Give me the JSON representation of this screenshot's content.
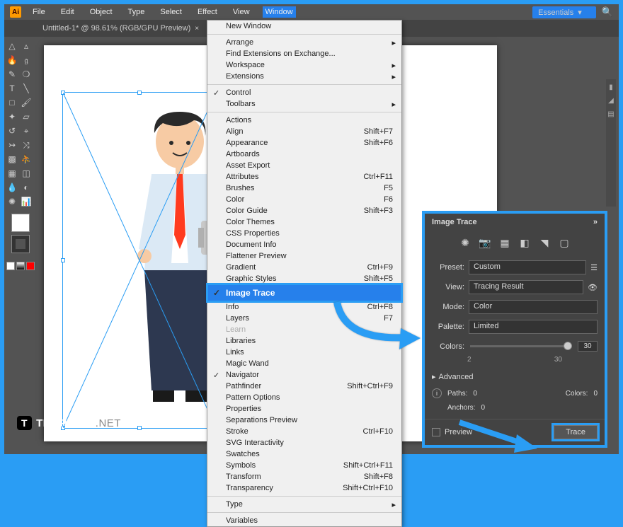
{
  "app": {
    "logo": "Ai",
    "title": "Untitled-1* @ 98.61% (RGB/GPU Preview)"
  },
  "menu": {
    "items": [
      "File",
      "Edit",
      "Object",
      "Type",
      "Select",
      "Effect",
      "View",
      "Window"
    ],
    "active": "Window"
  },
  "workspace_switcher": {
    "label": "Essentials"
  },
  "dropdown": {
    "top": [
      {
        "label": "New Window"
      },
      {
        "label": "Arrange",
        "sub": true
      },
      {
        "label": "Find Extensions on Exchange..."
      },
      {
        "label": "Workspace",
        "sub": true
      },
      {
        "label": "Extensions",
        "sub": true
      }
    ],
    "mid1": [
      {
        "label": "Control",
        "checked": true
      },
      {
        "label": "Toolbars",
        "sub": true
      }
    ],
    "list": [
      {
        "label": "Actions"
      },
      {
        "label": "Align",
        "shortcut": "Shift+F7"
      },
      {
        "label": "Appearance",
        "shortcut": "Shift+F6"
      },
      {
        "label": "Artboards"
      },
      {
        "label": "Asset Export"
      },
      {
        "label": "Attributes",
        "shortcut": "Ctrl+F11"
      },
      {
        "label": "Brushes",
        "shortcut": "F5"
      },
      {
        "label": "Color",
        "shortcut": "F6"
      },
      {
        "label": "Color Guide",
        "shortcut": "Shift+F3"
      },
      {
        "label": "Color Themes"
      },
      {
        "label": "CSS Properties"
      },
      {
        "label": "Document Info"
      },
      {
        "label": "Flattener Preview"
      },
      {
        "label": "Gradient",
        "shortcut": "Ctrl+F9"
      },
      {
        "label": "Graphic Styles",
        "shortcut": "Shift+F5"
      }
    ],
    "highlight": {
      "label": "Image Trace",
      "checked": true
    },
    "list2": [
      {
        "label": "Info",
        "shortcut": "Ctrl+F8"
      },
      {
        "label": "Layers",
        "shortcut": "F7"
      },
      {
        "label": "Learn",
        "disabled": true
      },
      {
        "label": "Libraries"
      },
      {
        "label": "Links"
      },
      {
        "label": "Magic Wand"
      },
      {
        "label": "Navigator",
        "checked": true
      },
      {
        "label": "Pathfinder",
        "shortcut": "Shift+Ctrl+F9"
      },
      {
        "label": "Pattern Options"
      },
      {
        "label": "Properties"
      },
      {
        "label": "Separations Preview"
      },
      {
        "label": "Stroke",
        "shortcut": "Ctrl+F10"
      },
      {
        "label": "SVG Interactivity"
      },
      {
        "label": "Swatches"
      },
      {
        "label": "Symbols",
        "shortcut": "Shift+Ctrl+F11"
      },
      {
        "label": "Transform",
        "shortcut": "Shift+F8"
      },
      {
        "label": "Transparency",
        "shortcut": "Shift+Ctrl+F10"
      },
      {
        "label": "Type",
        "sub": true
      },
      {
        "label": "Variables"
      }
    ]
  },
  "panel": {
    "title": "Image Trace",
    "preset_label": "Preset:",
    "preset": "Custom",
    "view_label": "View:",
    "view": "Tracing Result",
    "mode_label": "Mode:",
    "mode": "Color",
    "palette_label": "Palette:",
    "palette": "Limited",
    "colors_label": "Colors:",
    "colors_value": "30",
    "scale_min": "2",
    "scale_max": "30",
    "advanced": "Advanced",
    "paths_label": "Paths:",
    "paths": "0",
    "colors_stat_label": "Colors:",
    "colors_stat": "0",
    "anchors_label": "Anchors:",
    "anchors": "0",
    "preview": "Preview",
    "trace": "Trace"
  },
  "watermark": {
    "icon": "T",
    "brand": "TEMPLATE",
    "suffix": ".NET"
  }
}
